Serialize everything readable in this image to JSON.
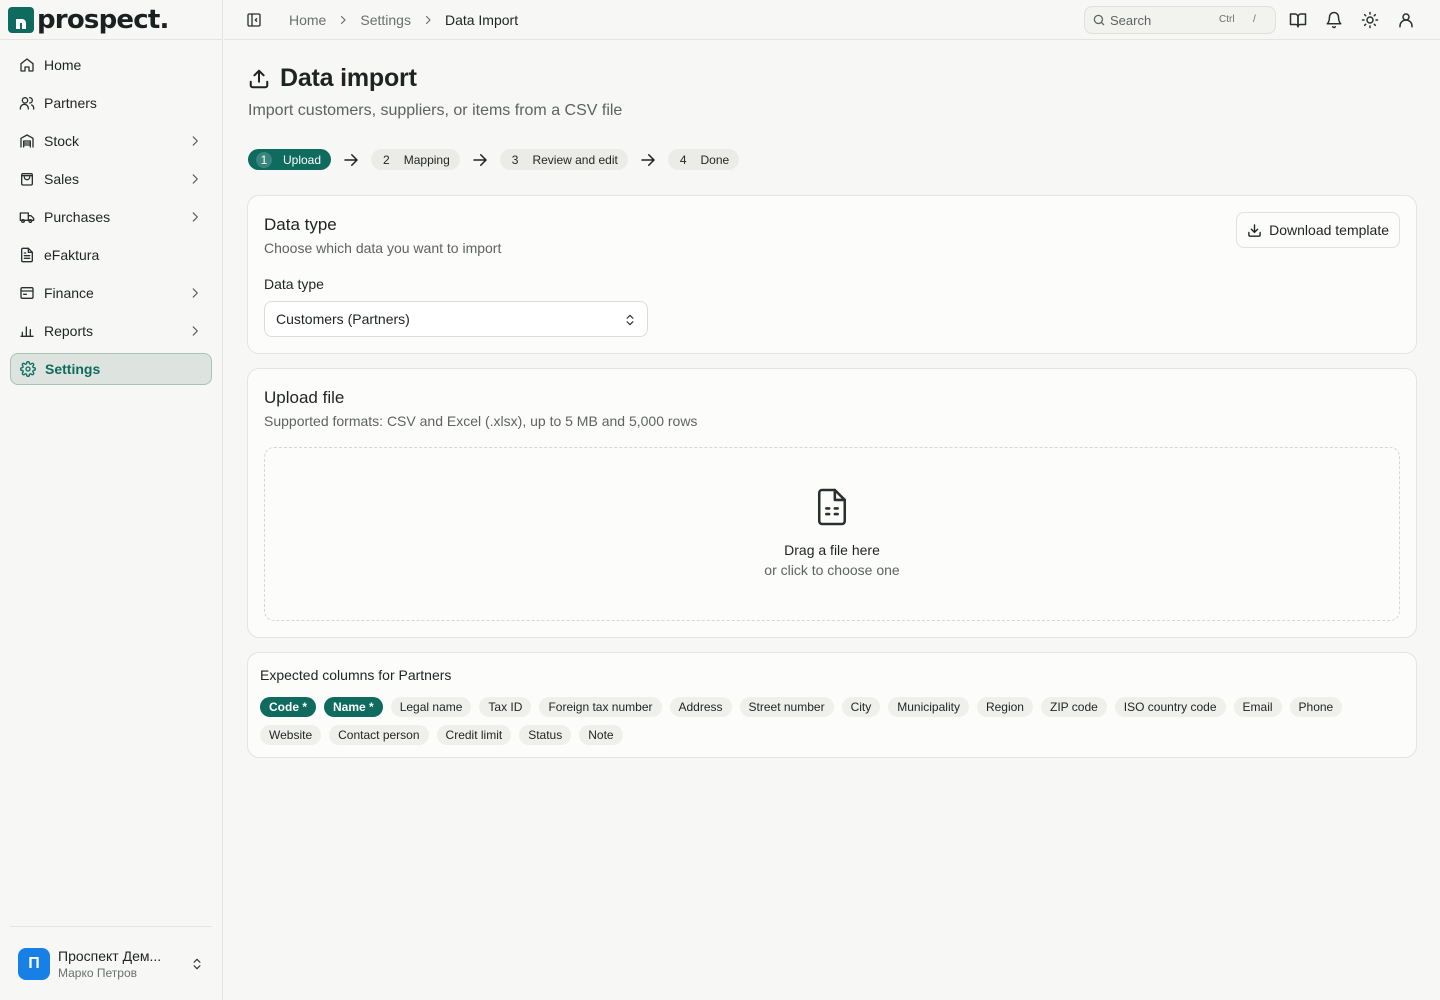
{
  "app": {
    "name": "prospect."
  },
  "sidebar": {
    "items": [
      {
        "label": "Home",
        "icon": "home-icon"
      },
      {
        "label": "Partners",
        "icon": "users-icon"
      },
      {
        "label": "Stock",
        "icon": "warehouse-icon",
        "expandable": true
      },
      {
        "label": "Sales",
        "icon": "shopping-bag-icon",
        "expandable": true
      },
      {
        "label": "Purchases",
        "icon": "truck-icon",
        "expandable": true
      },
      {
        "label": "eFaktura",
        "icon": "document-icon"
      },
      {
        "label": "Finance",
        "icon": "wallet-icon",
        "expandable": true
      },
      {
        "label": "Reports",
        "icon": "bar-chart-icon",
        "expandable": true
      },
      {
        "label": "Settings",
        "icon": "gear-icon",
        "active": true
      }
    ],
    "org": {
      "initial": "П",
      "name": "Проспект Дем...",
      "user": "Марко Петров",
      "avatar_color": "#1680e6"
    }
  },
  "topbar": {
    "breadcrumb": [
      "Home",
      "Settings",
      "Data Import"
    ],
    "search": {
      "label": "Search",
      "shortcut_key": "Ctrl",
      "shortcut_char": "/"
    }
  },
  "page": {
    "title": "Data import",
    "subtitle": "Import customers, suppliers, or items from a CSV file"
  },
  "steps": [
    {
      "num": "1",
      "label": "Upload",
      "active": true
    },
    {
      "num": "2",
      "label": "Mapping"
    },
    {
      "num": "3",
      "label": "Review and edit"
    },
    {
      "num": "4",
      "label": "Done"
    }
  ],
  "data_type_card": {
    "title": "Data type",
    "subtitle": "Choose which data you want to import",
    "download_label": "Download template",
    "field_label": "Data type",
    "selected_value": "Customers (Partners)"
  },
  "upload_card": {
    "title": "Upload file",
    "subtitle": "Supported formats: CSV and Excel (.xlsx), up to 5 MB and 5,000 rows",
    "drop_title": "Drag a file here",
    "drop_sub": "or click to choose one"
  },
  "columns_card": {
    "title": "Expected columns for Partners",
    "columns": [
      {
        "label": "Code *",
        "required": true
      },
      {
        "label": "Name *",
        "required": true
      },
      {
        "label": "Legal name"
      },
      {
        "label": "Tax ID"
      },
      {
        "label": "Foreign tax number"
      },
      {
        "label": "Address"
      },
      {
        "label": "Street number"
      },
      {
        "label": "City"
      },
      {
        "label": "Municipality"
      },
      {
        "label": "Region"
      },
      {
        "label": "ZIP code"
      },
      {
        "label": "ISO country code"
      },
      {
        "label": "Email"
      },
      {
        "label": "Phone"
      },
      {
        "label": "Website"
      },
      {
        "label": "Contact person"
      },
      {
        "label": "Credit limit"
      },
      {
        "label": "Status"
      },
      {
        "label": "Note"
      }
    ]
  },
  "colors": {
    "accent": "#0e6b5e",
    "background": "#f7f7f5",
    "card": "#fcfcfb"
  }
}
